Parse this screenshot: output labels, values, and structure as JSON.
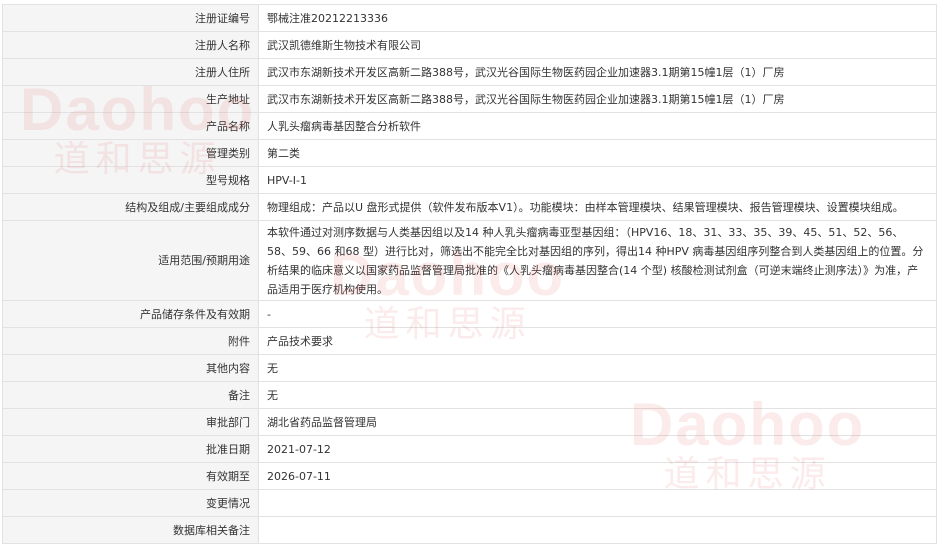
{
  "watermark": {
    "brand_en": "Daohoo",
    "brand_cn": "道和思源"
  },
  "rows": [
    {
      "label": "注册证编号",
      "value": "鄂械注准20212213336"
    },
    {
      "label": "注册人名称",
      "value": "武汉凯德维斯生物技术有限公司"
    },
    {
      "label": "注册人住所",
      "value": "武汉市东湖新技术开发区高新二路388号，武汉光谷国际生物医药园企业加速器3.1期第15幢1层（1）厂房"
    },
    {
      "label": "生产地址",
      "value": "武汉市东湖新技术开发区高新二路388号，武汉光谷国际生物医药园企业加速器3.1期第15幢1层（1）厂房"
    },
    {
      "label": "产品名称",
      "value": "人乳头瘤病毒基因整合分析软件"
    },
    {
      "label": "管理类别",
      "value": "第二类"
    },
    {
      "label": "型号规格",
      "value": "HPV-I-1"
    },
    {
      "label": "结构及组成/主要组成成分",
      "value": "物理组成：产品以U 盘形式提供（软件发布版本V1）。功能模块：由样本管理模块、结果管理模块、报告管理模块、设置模块组成。"
    },
    {
      "label": "适用范围/预期用途",
      "value": "本软件通过对测序数据与人类基因组以及14 种人乳头瘤病毒亚型基因组：（HPV16、18、31、33、35、39、45、51、52、56、58、59、66 和68 型）进行比对，筛选出不能完全比对基因组的序列，得出14 种HPV 病毒基因组序列整合到人类基因组上的位置。分析结果的临床意义以国家药品监督管理局批准的《人乳头瘤病毒基因整合(14 个型) 核酸检测试剂盒（可逆末端终止测序法）》为准，产品适用于医疗机构使用。"
    },
    {
      "label": "产品储存条件及有效期",
      "value": "-"
    },
    {
      "label": "附件",
      "value": "产品技术要求"
    },
    {
      "label": "其他内容",
      "value": "无"
    },
    {
      "label": "备注",
      "value": "无"
    },
    {
      "label": "审批部门",
      "value": "湖北省药品监督管理局"
    },
    {
      "label": "批准日期",
      "value": "2021-07-12"
    },
    {
      "label": "有效期至",
      "value": "2026-07-11"
    },
    {
      "label": "变更情况",
      "value": ""
    },
    {
      "label": "数据库相关备注",
      "value": ""
    }
  ]
}
